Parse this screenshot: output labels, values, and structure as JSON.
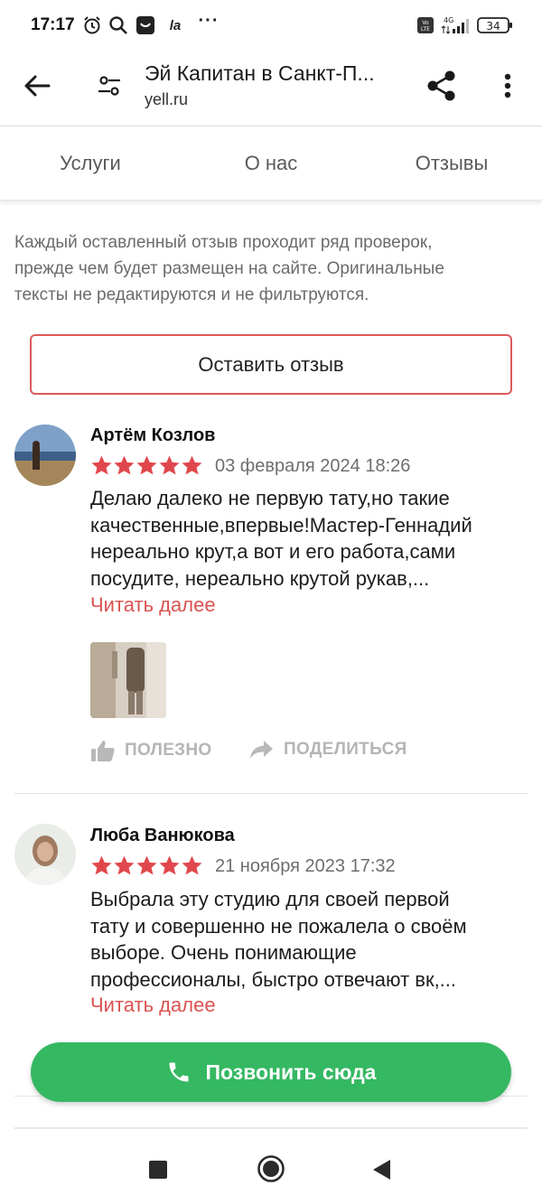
{
  "status_bar": {
    "time": "17:17",
    "la_text": "la",
    "more": "···",
    "network": "4G",
    "battery": "34",
    "icons": [
      "alarm-icon",
      "search-icon",
      "app-notification-icon",
      "volte-icon",
      "signal-icon",
      "battery-icon"
    ]
  },
  "app_bar": {
    "title": "Эй Капитан в Санкт-П...",
    "url": "yell.ru",
    "icons": [
      "back-arrow-icon",
      "filter-icon",
      "share-icon",
      "more-vert-icon"
    ]
  },
  "tabs": [
    "Услуги",
    "О нас",
    "Отзывы"
  ],
  "intro": {
    "lines": [
      "Каждый оставленный отзыв проходит ряд проверок,",
      "прежде чем будет размещен на сайте. Оригинальные",
      "тексты не редактируются и не фильтруются."
    ],
    "button": "Оставить отзыв"
  },
  "reviews": [
    {
      "name": "Артём Козлов",
      "rating": 5,
      "date": "03 февраля 2024 18:26",
      "text_lines": [
        "Делаю далеко не первую тату,но такие",
        "качественные,впервые!Мастер-Геннадий",
        "нереально крут,а вот и его работа,сами",
        "посудите, нереально крутой рукав,..."
      ],
      "read_more": "Читать далее",
      "actions": {
        "useful": "ПОЛЕЗНО",
        "share": "ПОДЕЛИТЬСЯ"
      }
    },
    {
      "name": "Люба Ванюкова",
      "rating": 5,
      "date": "21 ноября 2023 17:32",
      "text_lines": [
        "Выбрала эту студию для своей первой",
        "тату и совершенно не пожалела о своём",
        "выборе. Очень понимающие",
        "профессионалы, быстро отвечают вк,..."
      ],
      "read_more": "Читать далее"
    }
  ],
  "call_button": "Позвонить сюда",
  "colors": {
    "accent_red": "#d9534f",
    "star_red": "#e0474c",
    "call_green": "#35b862",
    "muted_text": "#6b6b6b"
  }
}
